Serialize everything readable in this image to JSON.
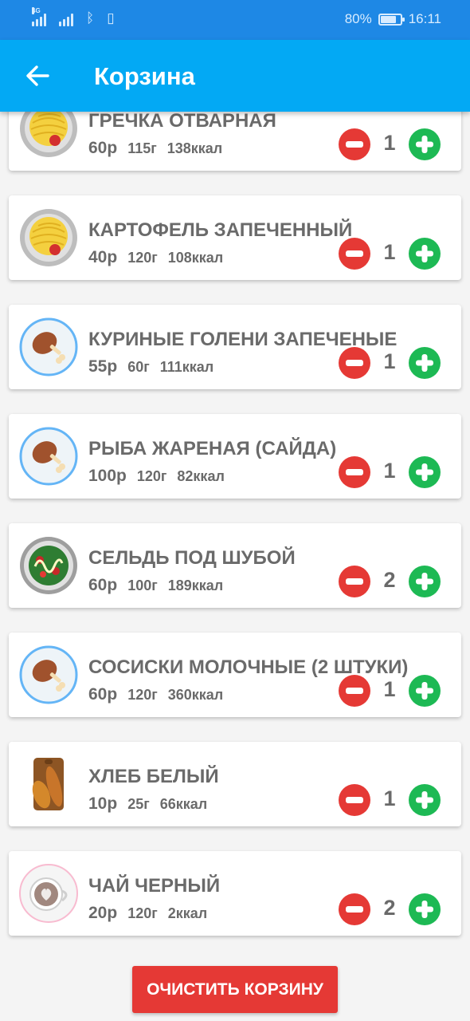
{
  "status_bar": {
    "network_label": "4G",
    "battery": "80%",
    "battery_level": 0.8,
    "time": "16:11"
  },
  "app_bar": {
    "title": "Корзина",
    "back_icon": "arrow-left-icon"
  },
  "cart": {
    "items": [
      {
        "name": "ГРЕЧКА ОТВАРНАЯ",
        "price": "60р",
        "weight": "115г",
        "kcal": "138ккал",
        "qty": "1",
        "icon": "pasta-plate-icon"
      },
      {
        "name": "КАРТОФЕЛЬ ЗАПЕЧЕННЫЙ",
        "price": "40р",
        "weight": "120г",
        "kcal": "108ккал",
        "qty": "1",
        "icon": "pasta-plate-icon"
      },
      {
        "name": "КУРИНЫЕ ГОЛЕНИ ЗАПЕЧЕНЫЕ",
        "price": "55р",
        "weight": "60г",
        "kcal": "111ккал",
        "qty": "1",
        "icon": "chicken-leg-icon"
      },
      {
        "name": "РЫБА ЖАРЕНАЯ (САЙДА)",
        "price": "100р",
        "weight": "120г",
        "kcal": "82ккал",
        "qty": "1",
        "icon": "chicken-leg-icon"
      },
      {
        "name": "СЕЛЬДЬ ПОД ШУБОЙ",
        "price": "60р",
        "weight": "100г",
        "kcal": "189ккал",
        "qty": "2",
        "icon": "salad-plate-icon"
      },
      {
        "name": "СОСИСКИ МОЛОЧНЫЕ (2 ШТУКИ)",
        "price": "60р",
        "weight": "120г",
        "kcal": "360ккал",
        "qty": "1",
        "icon": "chicken-leg-icon"
      },
      {
        "name": "ХЛЕБ БЕЛЫЙ",
        "price": "10р",
        "weight": "25г",
        "kcal": "66ккал",
        "qty": "1",
        "icon": "bread-board-icon"
      },
      {
        "name": "ЧАЙ ЧЕРНЫЙ",
        "price": "20р",
        "weight": "120г",
        "kcal": "2ккал",
        "qty": "2",
        "icon": "coffee-cup-icon"
      }
    ]
  },
  "clear_button": "ОЧИСТИТЬ КОРЗИНУ",
  "colors": {
    "status_bar": "#1e88e5",
    "app_bar": "#03a9f4",
    "minus": "#e53935",
    "plus": "#1db954",
    "clear_button": "#e53935",
    "text": "#6a6a6a"
  }
}
